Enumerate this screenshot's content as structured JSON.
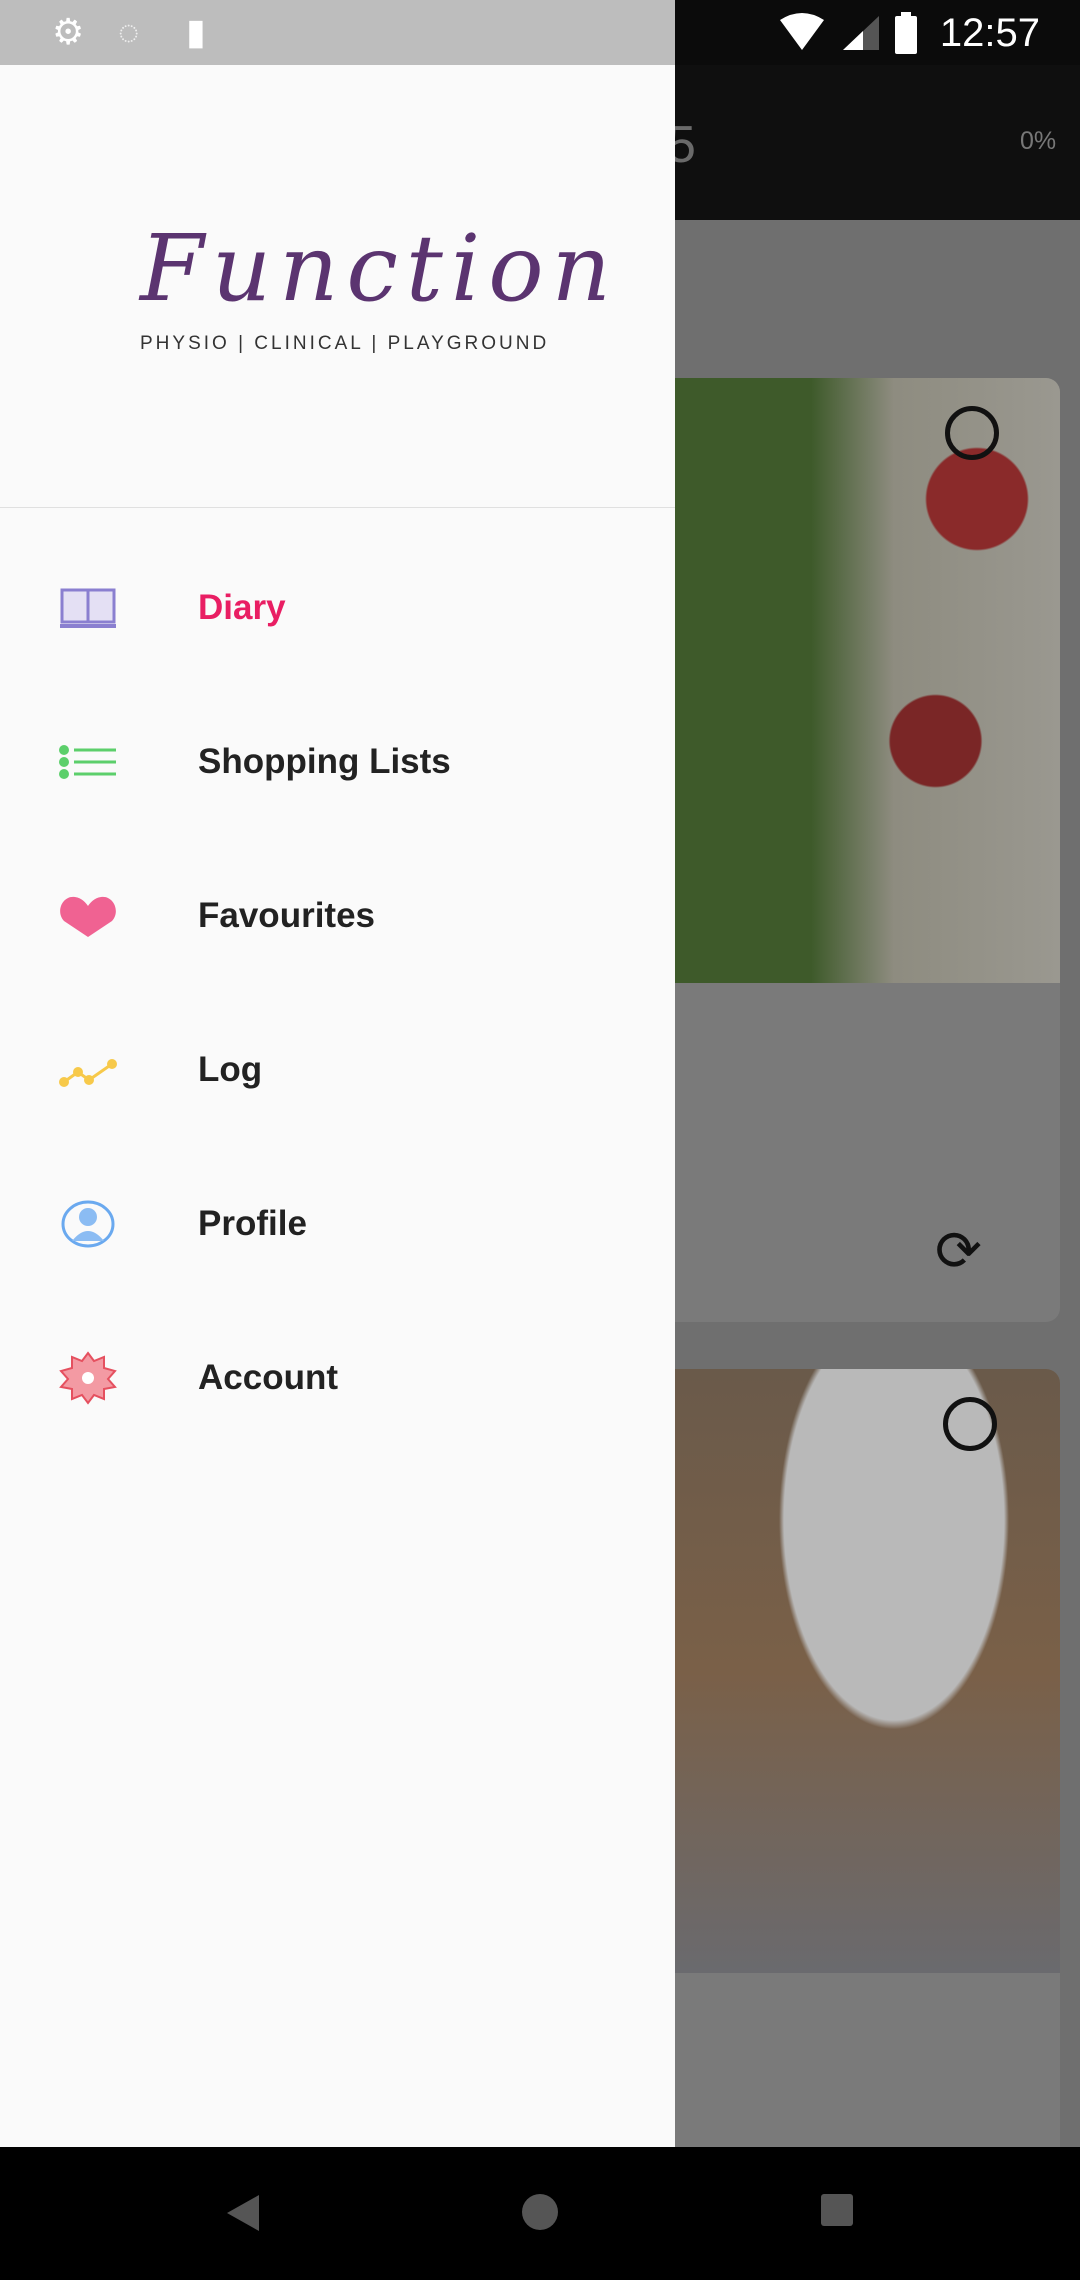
{
  "status_bar": {
    "time": "12:57",
    "icons": [
      "gear-icon",
      "sync-circle-icon",
      "sd-card-icon",
      "wifi-icon",
      "signal-icon",
      "battery-icon"
    ]
  },
  "app_bar": {
    "partial_title": "5",
    "percent": "0%"
  },
  "drawer": {
    "logo": {
      "script": "Function",
      "tagline": "PHYSIO | CLINICAL |  PLAYGROUND"
    },
    "items": [
      {
        "label": "Diary",
        "icon": "book-icon",
        "active": true,
        "color": "#e91e63"
      },
      {
        "label": "Shopping Lists",
        "icon": "list-icon",
        "active": false
      },
      {
        "label": "Favourites",
        "icon": "heart-icon",
        "active": false
      },
      {
        "label": "Log",
        "icon": "chart-line-icon",
        "active": false
      },
      {
        "label": "Profile",
        "icon": "user-icon",
        "active": false
      },
      {
        "label": "Account",
        "icon": "gear-icon",
        "active": false
      }
    ]
  },
  "nav_bar": {
    "buttons": [
      "back",
      "home",
      "recents"
    ]
  }
}
